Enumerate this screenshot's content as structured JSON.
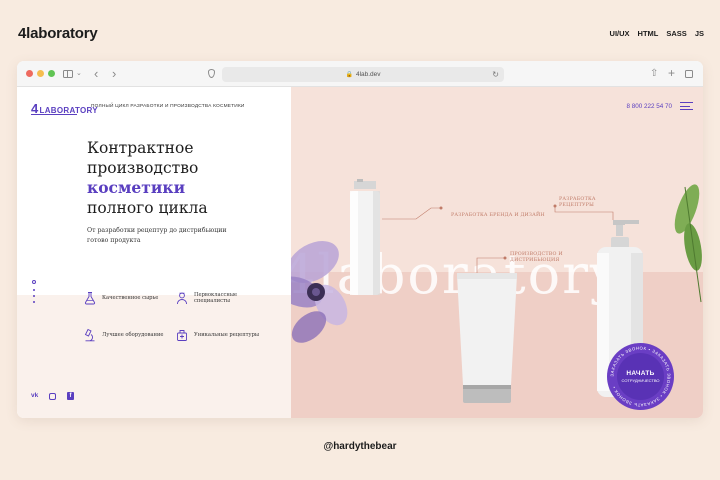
{
  "portfolio": {
    "title": "4laboratory",
    "tech": [
      "UI/UX",
      "HTML",
      "SASS",
      "JS"
    ],
    "credit": "@hardythebear"
  },
  "browser": {
    "url": "4lab.dev"
  },
  "site": {
    "logo_mark": "4",
    "logo_text": "LABORATORY",
    "tagline": "ПОЛНЫЙ ЦИКЛ РАЗРАБОТКИ И ПРОИЗВОДСТВА КОСМЕТИКИ",
    "phone": "8 800 222 54 70",
    "headline_1": "Контрактное",
    "headline_2": "производство",
    "headline_accent": "косметики",
    "headline_3": "полного цикла",
    "subtitle": "От разработки рецептур до дистрибьюции готово продукта",
    "features": [
      {
        "text": "Качественное сырье",
        "icon": "flask-icon"
      },
      {
        "text": "Первоклассные специалисты",
        "icon": "specialist-icon"
      },
      {
        "text": "Лучшее оборудование",
        "icon": "microscope-icon"
      },
      {
        "text": "Уникальные рецептуры",
        "icon": "recipe-icon"
      }
    ],
    "social": [
      "vk-icon",
      "instagram-icon",
      "facebook-icon"
    ],
    "watermark": "4laboratory",
    "labels": {
      "brand": "РАЗРАБОТКА БРЕНДА И ДИЗАЙН",
      "recipes": "РАЗРАБОТКА РЕЦЕПТУРЫ",
      "production": "ПРОИЗВОДСТВО И ДИСТРИБЬЮЦИЯ"
    },
    "cta_title": "НАЧАТЬ",
    "cta_sub": "СОТРУДНИЧЕСТВО",
    "cta_ring": "ЗАКАЗАТЬ ЗВОНОК • ЗАКАЗАТЬ ЗВОНОК • ЗАКАЗАТЬ ЗВОНОК •"
  },
  "colors": {
    "accent": "#5a3fc0",
    "backdrop": "#f8ebe0",
    "pink": "#f6e2da",
    "label": "#c07b68"
  }
}
